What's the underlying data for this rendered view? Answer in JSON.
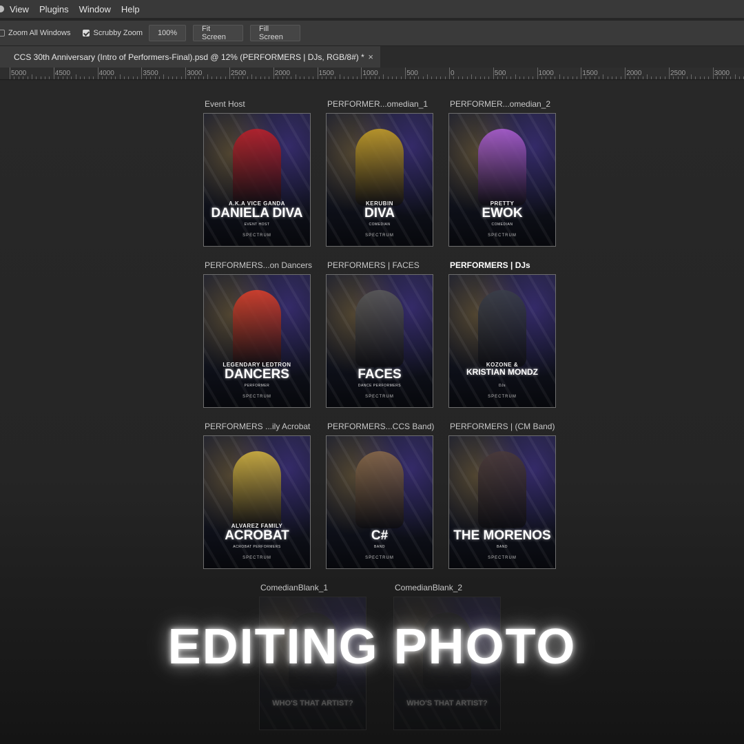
{
  "menu": {
    "items": [
      "View",
      "Plugins",
      "Window",
      "Help"
    ]
  },
  "options": {
    "zoom_all_windows": "Zoom All Windows",
    "zoom_all_checked": false,
    "scrubby_zoom": "Scrubby Zoom",
    "scrubby_checked": true,
    "zoom_value": "100%",
    "fit_screen": "Fit Screen",
    "fill_screen": "Fill Screen"
  },
  "document": {
    "tab_title": "CCS 30th Anniversary (Intro of Performers-Final).psd @ 12% (PERFORMERS | DJs, RGB/8#) *",
    "close_glyph": "×"
  },
  "ruler": {
    "labels": [
      "5000",
      "4500",
      "4000",
      "3500",
      "3000",
      "2500",
      "2000",
      "1500",
      "1000",
      "500",
      "0",
      "500",
      "1000",
      "1500",
      "2000",
      "2500",
      "3000"
    ]
  },
  "artboards": [
    {
      "label": "Event Host",
      "subtitle": "A.K.A VICE GANDA",
      "title": "DANIELA DIVA",
      "role": "EVENT HOST",
      "accent": "#c0202a",
      "active": false
    },
    {
      "label": "PERFORMER...omedian_1",
      "subtitle": "KERUBIN",
      "title": "DIVA",
      "role": "COMEDIAN",
      "accent": "#c9a227",
      "active": false
    },
    {
      "label": "PERFORMER...omedian_2",
      "subtitle": "PRETTY",
      "title": "EWOK",
      "role": "COMEDIAN",
      "accent": "#b060d8",
      "active": false
    },
    {
      "label": "PERFORMERS...on Dancers",
      "subtitle": "LEGENDARY LEDTRON",
      "title": "DANCERS",
      "role": "PERFORMER",
      "accent": "#e0402a",
      "active": false
    },
    {
      "label": "PERFORMERS | FACES",
      "subtitle": "",
      "title": "FACES",
      "role": "DANCE PERFORMERS",
      "accent": "#5a5a5a",
      "active": false
    },
    {
      "label": "PERFORMERS | DJs",
      "subtitle": "KOZONE &",
      "title": "KRISTIAN MONDZ",
      "role": "DJs",
      "accent": "#3a3f4a",
      "active": true
    },
    {
      "label": "PERFORMERS ...ily Acrobat",
      "subtitle": "ALVAREZ FAMILY",
      "title": "ACROBAT",
      "role": "ACROBAT PERFORMERS",
      "accent": "#d8b840",
      "active": false
    },
    {
      "label": "PERFORMERS...CCS Band)",
      "subtitle": "",
      "title": "C#",
      "role": "BAND",
      "accent": "#8a6a4a",
      "active": false
    },
    {
      "label": "PERFORMERS | (CM Band)",
      "subtitle": "",
      "title": "THE MORENOS",
      "role": "BAND",
      "accent": "#4a3a3a",
      "active": false
    },
    {
      "label": "ComedianBlank_1",
      "subtitle": "",
      "title": "WHO'S THAT ARTIST?",
      "role": "",
      "accent": "#333333",
      "active": false
    },
    {
      "label": "ComedianBlank_2",
      "subtitle": "",
      "title": "WHO'S THAT ARTIST?",
      "role": "",
      "accent": "#333333",
      "active": false
    }
  ],
  "poster_footer": "SPECTRUM",
  "overlay": {
    "heading": "EDITING PHOTO"
  }
}
